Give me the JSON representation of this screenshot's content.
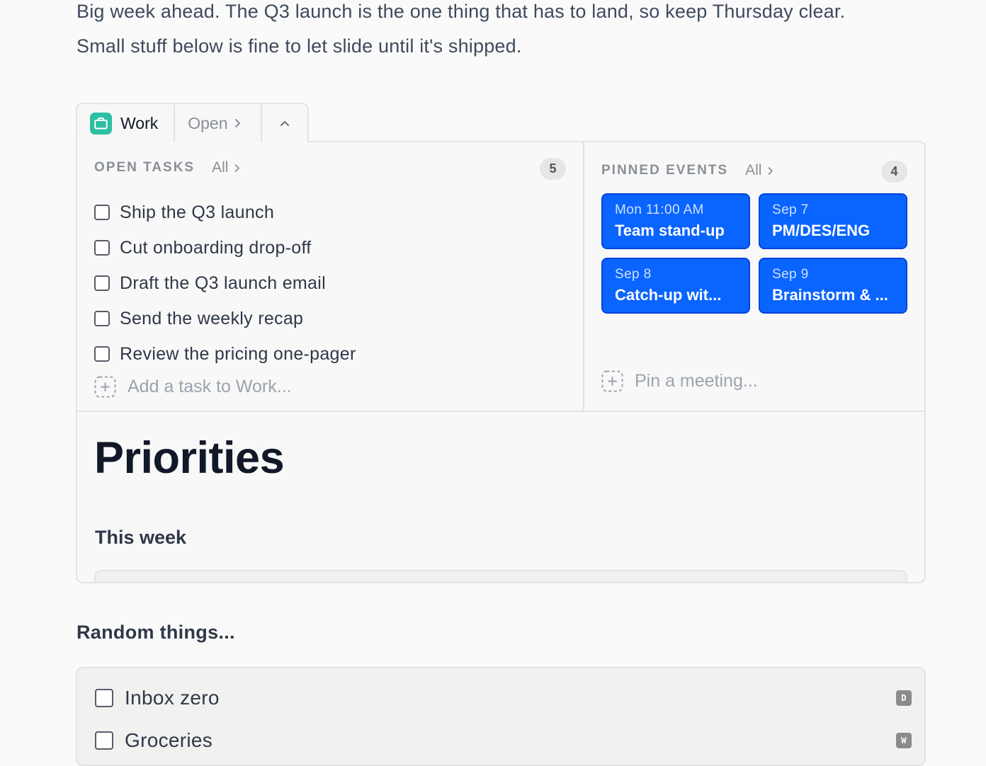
{
  "intro": {
    "line1": "Big week ahead. The Q3 launch is the one thing that has to land, so keep Thursday clear.",
    "line2": "Small stuff below is fine to let slide until it's shipped."
  },
  "tabs": {
    "work_label": "Work",
    "open_label": "Open"
  },
  "open_tasks": {
    "title": "OPEN TASKS",
    "all_label": "All",
    "count": "5",
    "items": [
      {
        "label": "Ship the Q3 launch"
      },
      {
        "label": "Cut onboarding drop-off"
      },
      {
        "label": "Draft the Q3 launch email"
      },
      {
        "label": "Send the weekly recap"
      },
      {
        "label": "Review the pricing one-pager"
      }
    ],
    "add_placeholder": "Add a task to Work..."
  },
  "pinned_events": {
    "title": "PINNED EVENTS",
    "all_label": "All",
    "count": "4",
    "items": [
      {
        "time": "Mon 11:00 AM",
        "title": "Team stand-up"
      },
      {
        "time": "Sep 7",
        "title": "PM/DES/ENG"
      },
      {
        "time": "Sep 8",
        "title": "Catch-up wit..."
      },
      {
        "time": "Sep 9",
        "title": "Brainstorm & ..."
      }
    ],
    "pin_placeholder": "Pin a meeting..."
  },
  "document": {
    "heading": "Priorities",
    "subheading": "This week"
  },
  "random": {
    "title": "Random things...",
    "items": [
      {
        "label": "Inbox zero",
        "key": "D"
      },
      {
        "label": "Groceries",
        "key": "W"
      }
    ]
  },
  "colors": {
    "accent_blue": "#0a64ff",
    "work_icon": "#2dbfa3"
  },
  "icons": {
    "work": "briefcase-icon",
    "chevron": "chevron-right-icon",
    "collapse": "chevron-up-icon",
    "add": "dashed-plus-icon"
  }
}
